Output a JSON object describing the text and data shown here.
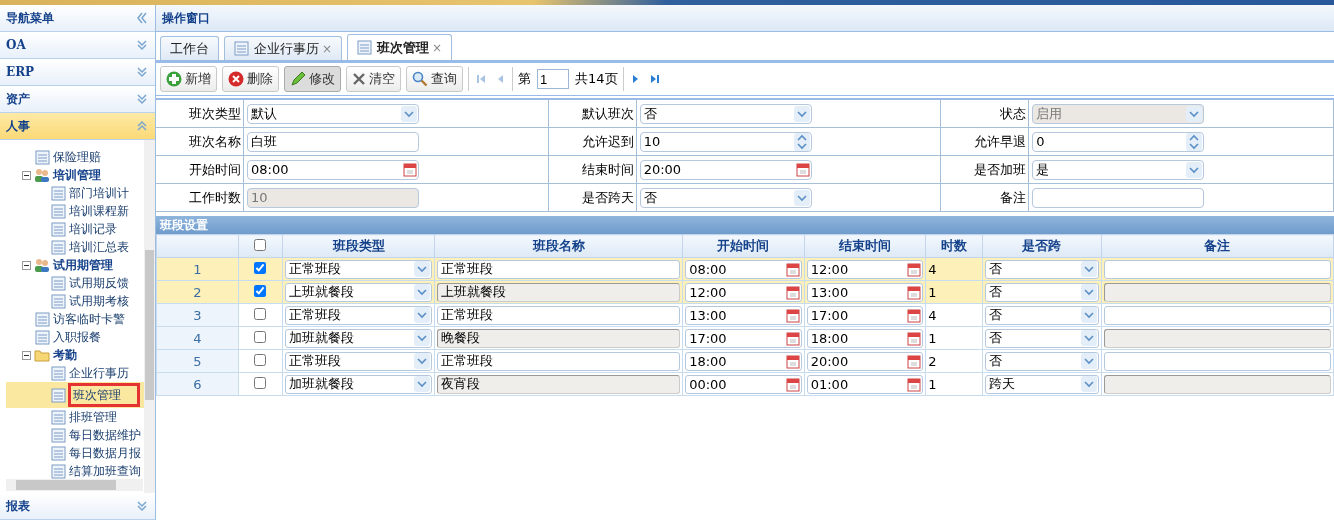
{
  "sidebar": {
    "title": "导航菜单",
    "sections": [
      {
        "label": "OA",
        "expanded": false
      },
      {
        "label": "ERP",
        "expanded": false
      },
      {
        "label": "资产",
        "expanded": false
      },
      {
        "label": "人事",
        "expanded": true
      }
    ],
    "tree": [
      {
        "label": "保险理赔",
        "kind": "leaf",
        "selected": false
      },
      {
        "label": "培训管理",
        "kind": "group",
        "expanded": true,
        "children": [
          {
            "label": "部门培训计",
            "kind": "leaf",
            "selected": false
          },
          {
            "label": "培训课程新",
            "kind": "leaf",
            "selected": false
          },
          {
            "label": "培训记录",
            "kind": "leaf",
            "selected": false
          },
          {
            "label": "培训汇总表",
            "kind": "leaf",
            "selected": false
          }
        ]
      },
      {
        "label": "试用期管理",
        "kind": "group",
        "expanded": true,
        "children": [
          {
            "label": "试用期反馈",
            "kind": "leaf",
            "selected": false
          },
          {
            "label": "试用期考核",
            "kind": "leaf",
            "selected": false
          }
        ]
      },
      {
        "label": "访客临时卡警",
        "kind": "leaf",
        "selected": false
      },
      {
        "label": "入职报餐",
        "kind": "leaf",
        "selected": false
      },
      {
        "label": "考勤",
        "kind": "folder",
        "expanded": true,
        "children": [
          {
            "label": "企业行事历",
            "kind": "leaf",
            "selected": false
          },
          {
            "label": "班次管理",
            "kind": "leaf",
            "selected": true
          },
          {
            "label": "排班管理",
            "kind": "leaf",
            "selected": false
          },
          {
            "label": "每日数据维护",
            "kind": "leaf",
            "selected": false
          },
          {
            "label": "每日数据月报",
            "kind": "leaf",
            "selected": false
          },
          {
            "label": "结算加班查询",
            "kind": "leaf",
            "selected": false
          }
        ]
      }
    ],
    "footer": {
      "label": "报表",
      "expanded": false
    }
  },
  "main": {
    "title": "操作窗口",
    "tabs": [
      {
        "label": "工作台",
        "closable": false,
        "selected": false
      },
      {
        "label": "企业行事历",
        "closable": true,
        "selected": false
      },
      {
        "label": "班次管理",
        "closable": true,
        "selected": true
      }
    ],
    "close_mark": "×",
    "toolbar": [
      {
        "label": "新增",
        "kind": "add",
        "pressed": false
      },
      {
        "label": "删除",
        "kind": "delete",
        "pressed": false
      },
      {
        "label": "修改",
        "kind": "edit",
        "pressed": true
      },
      {
        "label": "清空",
        "kind": "clear",
        "pressed": false
      },
      {
        "label": "查询",
        "kind": "search",
        "pressed": false
      }
    ],
    "pager": {
      "prefix": "第",
      "page": "1",
      "total": "共14页"
    },
    "form": [
      [
        {
          "label": "班次类型",
          "kind": "select",
          "value": "默认",
          "disabled": false
        },
        {
          "label": "默认班次",
          "kind": "select",
          "value": "否",
          "disabled": false
        },
        {
          "label": "状态",
          "kind": "select",
          "value": "启用",
          "disabled": true
        }
      ],
      [
        {
          "label": "班次名称",
          "kind": "text",
          "value": "白班",
          "disabled": false
        },
        {
          "label": "允许迟到",
          "kind": "spin",
          "value": "10",
          "disabled": false
        },
        {
          "label": "允许早退",
          "kind": "spin",
          "value": "0",
          "disabled": false
        }
      ],
      [
        {
          "label": "开始时间",
          "kind": "date",
          "value": "08:00",
          "disabled": false
        },
        {
          "label": "结束时间",
          "kind": "date",
          "value": "20:00",
          "disabled": false
        },
        {
          "label": "是否加班",
          "kind": "select",
          "value": "是",
          "disabled": false
        }
      ],
      [
        {
          "label": "工作时数",
          "kind": "text",
          "value": "10",
          "disabled": true
        },
        {
          "label": "是否跨天",
          "kind": "select",
          "value": "否",
          "disabled": false
        },
        {
          "label": "备注",
          "kind": "text",
          "disabled": false
        }
      ]
    ],
    "grid": {
      "title": "班段设置",
      "columns": [
        "班段类型",
        "班段名称",
        "开始时间",
        "结束时间",
        "时数",
        "是否跨",
        "备注"
      ],
      "all_checked": false,
      "rows": [
        {
          "index": "1",
          "checked": true,
          "type": "正常班段",
          "name": "正常班段",
          "start": "08:00",
          "end": "12:00",
          "hours": "4",
          "cross": "否",
          "readonly": false
        },
        {
          "index": "2",
          "checked": true,
          "type": "上班就餐段",
          "name": "上班就餐段",
          "start": "12:00",
          "end": "13:00",
          "hours": "1",
          "cross": "否",
          "readonly": true
        },
        {
          "index": "3",
          "checked": false,
          "type": "正常班段",
          "name": "正常班段",
          "start": "13:00",
          "end": "17:00",
          "hours": "4",
          "cross": "否",
          "readonly": false
        },
        {
          "index": "4",
          "checked": false,
          "type": "加班就餐段",
          "name": "晚餐段",
          "start": "17:00",
          "end": "18:00",
          "hours": "1",
          "cross": "否",
          "readonly": true
        },
        {
          "index": "5",
          "checked": false,
          "type": "正常班段",
          "name": "正常班段",
          "start": "18:00",
          "end": "20:00",
          "hours": "2",
          "cross": "否",
          "readonly": false
        },
        {
          "index": "6",
          "checked": false,
          "type": "加班就餐段",
          "name": "夜宵段",
          "start": "00:00",
          "end": "01:00",
          "hours": "1",
          "cross": "跨天",
          "readonly": true
        }
      ]
    }
  }
}
